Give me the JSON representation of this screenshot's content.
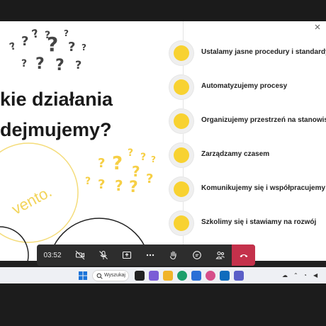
{
  "slide": {
    "title_line1": "kie działania",
    "title_line2": "dejmujemy?",
    "watermark": "vento.",
    "items": [
      {
        "label": "Ustalamy jasne procedury i standardy"
      },
      {
        "label": "Automatyzujemy procesy"
      },
      {
        "label": "Organizujemy przestrzeń na stanowisk"
      },
      {
        "label": "Zarządzamy czasem"
      },
      {
        "label": "Komunikujemy się i współpracujemy"
      },
      {
        "label": "Szkolimy się i stawiamy na rozwój"
      }
    ],
    "accent_color": "#f8d231"
  },
  "call_bar": {
    "timer": "03:52",
    "buttons": [
      "camera-off-icon",
      "mic-off-icon",
      "share-screen-icon",
      "more-icon",
      "raise-hand-icon",
      "chat-icon",
      "people-icon",
      "hang-up-icon"
    ],
    "hangup_color": "#c4314b"
  },
  "taskbar": {
    "search_placeholder": "Wyszukaj"
  }
}
